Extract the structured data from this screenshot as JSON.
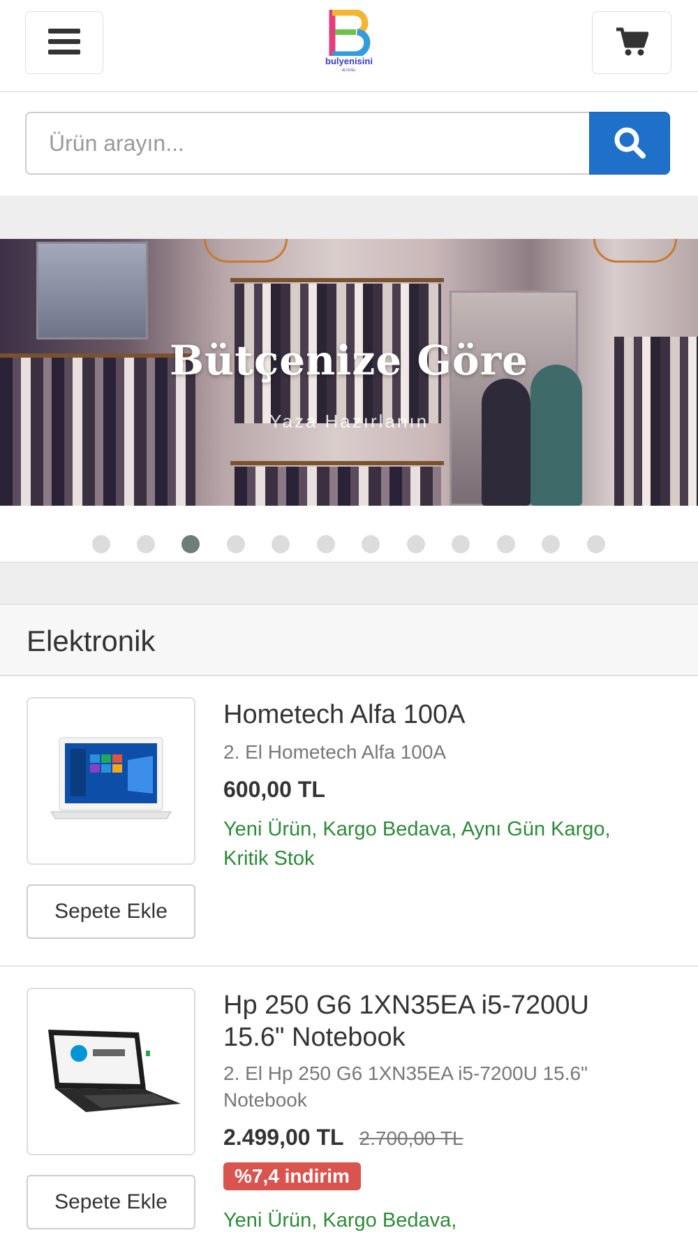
{
  "header": {
    "logo_text": "bulyenisini",
    "logo_sub": "ALISVEL"
  },
  "search": {
    "placeholder": "Ürün arayın..."
  },
  "banner": {
    "title": "Bütçenize Göre",
    "subtitle": "Yaza Hazırlanın",
    "slide_count": 12,
    "active_slide": 3
  },
  "category": {
    "title": "Elektronik"
  },
  "products": [
    {
      "name": "Hometech Alfa 100A",
      "description": "2. El Hometech Alfa 100A",
      "price": "600,00 TL",
      "tags": "Yeni Ürün, Kargo Bedava, Aynı Gün Kargo, Kritik Stok",
      "add_to_cart": "Sepete Ekle"
    },
    {
      "name": "Hp 250 G6 1XN35EA i5-7200U 15.6\" Notebook",
      "description": "2. El Hp 250 G6 1XN35EA i5-7200U 15.6\" Notebook",
      "price": "2.499,00 TL",
      "old_price": "2.700,00 TL",
      "discount": "%7,4 indirim",
      "tags": "Yeni Ürün, Kargo Bedava,",
      "add_to_cart": "Sepete Ekle"
    }
  ],
  "colors": {
    "accent": "#1f70c9",
    "tag_green": "#2d8a38",
    "discount_red": "#d9534f"
  }
}
